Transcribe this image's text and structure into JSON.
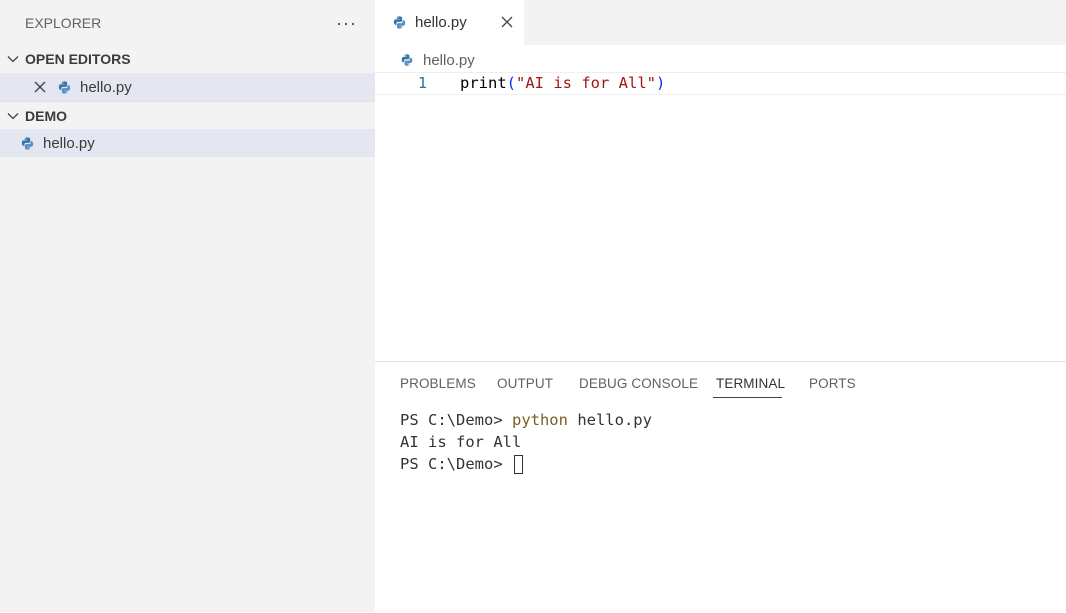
{
  "sidebar": {
    "title": "EXPLORER",
    "more": "···",
    "open_editors": {
      "title": "OPEN EDITORS",
      "items": [
        {
          "label": "hello.py"
        }
      ]
    },
    "demo": {
      "title": "DEMO",
      "items": [
        {
          "label": "hello.py"
        }
      ]
    }
  },
  "editor": {
    "tab": {
      "label": "hello.py"
    },
    "breadcrumb": "hello.py",
    "line_number": "1",
    "code": {
      "fn": "print",
      "open_paren": "(",
      "string": "\"AI is for All\"",
      "close_paren": ")"
    }
  },
  "panel": {
    "tabs": [
      "PROBLEMS",
      "OUTPUT",
      "DEBUG CONSOLE",
      "TERMINAL",
      "PORTS"
    ],
    "active_tab": "TERMINAL",
    "terminal": {
      "line1_prompt": "PS C:\\Demo> ",
      "line1_cmd": "python",
      "line1_arg": " hello.py",
      "line2": "AI is for All",
      "line3_prompt": "PS C:\\Demo> "
    }
  },
  "colors": {
    "sidebar_bg": "#f3f3f3",
    "selection": "#e4e6f1",
    "python_icon": "#3776ab",
    "string": "#a31515",
    "command": "#795e26"
  }
}
